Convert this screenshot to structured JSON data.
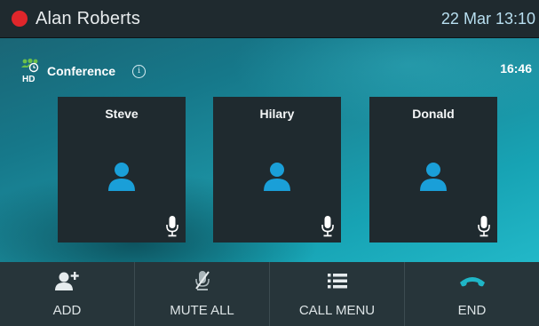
{
  "status_bar": {
    "user_name": "Alan Roberts",
    "datetime": "22 Mar 13:10",
    "status_color": "#e0262b"
  },
  "call": {
    "title": "Conference",
    "hd_badge": "HD",
    "duration": "16:46",
    "participants": [
      {
        "name": "Steve"
      },
      {
        "name": "Hilary"
      },
      {
        "name": "Donald"
      }
    ]
  },
  "softkeys": [
    {
      "label": "ADD",
      "icon": "add-participant-icon"
    },
    {
      "label": "MUTE ALL",
      "icon": "mute-all-icon"
    },
    {
      "label": "CALL MENU",
      "icon": "call-menu-icon"
    },
    {
      "label": "END",
      "icon": "end-call-icon"
    }
  ],
  "colors": {
    "accent": "#1a9fd8",
    "conference_green": "#6cc04a",
    "end_call": "#1fb6c7"
  }
}
